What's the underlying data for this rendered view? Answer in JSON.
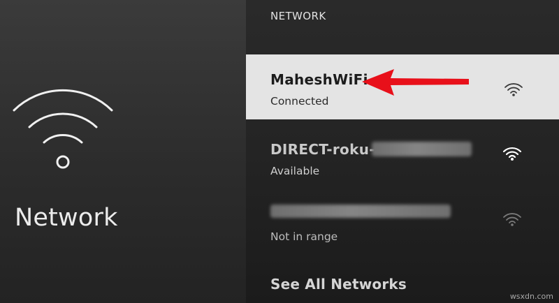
{
  "left": {
    "icon": "wifi-icon",
    "title": "Network"
  },
  "section_header": "NETWORK",
  "networks": [
    {
      "name": "MaheshWiFi",
      "status": "Connected",
      "selected": true,
      "signal_icon": "wifi-signal-icon"
    },
    {
      "name": "DIRECT-roku-",
      "name_suffix_blurred": true,
      "status": "Available",
      "selected": false,
      "signal_icon": "wifi-signal-icon"
    },
    {
      "name_blurred": true,
      "status": "Not in range",
      "selected": false,
      "signal_icon": "wifi-signal-icon"
    }
  ],
  "see_all": "See All Networks",
  "annotation": {
    "icon": "red-arrow-icon",
    "color": "#e8101a"
  },
  "watermark": "wsxdn.com",
  "colors": {
    "selected_row_bg": "#e4e4e4",
    "arrow": "#e8101a",
    "text_primary": "#ffffff"
  }
}
